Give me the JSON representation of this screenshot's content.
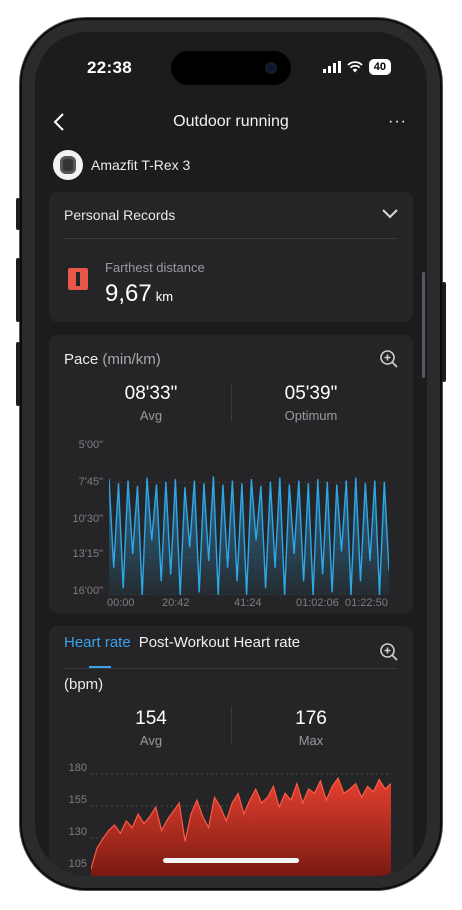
{
  "status_bar": {
    "time": "22:38",
    "battery": "40"
  },
  "header": {
    "title": "Outdoor running",
    "more": "···"
  },
  "device": {
    "name": "Amazfit T-Rex 3"
  },
  "personal_records": {
    "title": "Personal Records",
    "record_label": "Farthest distance",
    "record_value": "9,67",
    "record_unit": "km"
  },
  "pace": {
    "title": "Pace",
    "unit": "(min/km)",
    "avg_value": "08'33\"",
    "avg_label": "Avg",
    "optimum_value": "05'39\"",
    "optimum_label": "Optimum",
    "y_ticks": [
      "5'00\"",
      "7'45\"",
      "10'30\"",
      "13'15\"",
      "16'00\""
    ],
    "x_ticks": [
      "00:00",
      "20:42",
      "41:24",
      "01:02:06",
      "01:22:50"
    ]
  },
  "heart_rate": {
    "tab_active": "Heart rate",
    "tab_other": "Post-Workout Heart rate",
    "unit": "(bpm)",
    "avg_value": "154",
    "avg_label": "Avg",
    "max_value": "176",
    "max_label": "Max",
    "y_ticks": [
      "180",
      "155",
      "130",
      "105"
    ]
  },
  "colors": {
    "pace_line": "#2fa6e6",
    "heart_fill": "#e5402f",
    "accent": "#3aa0e8"
  },
  "chart_data": [
    {
      "type": "area",
      "title": "Pace",
      "ylabel": "(min/km)",
      "y_ticks": [
        "5'00\"",
        "7'45\"",
        "10'30\"",
        "13'15\"",
        "16'00\""
      ],
      "x_ticks": [
        "00:00",
        "20:42",
        "41:24",
        "01:02:06",
        "01:22:50"
      ],
      "ylim_min_per_km": [
        5.0,
        16.0
      ],
      "y_inverted": true,
      "series": [
        {
          "values": [
            7.5,
            14,
            7.8,
            15.5,
            7.6,
            13,
            8,
            16,
            7.4,
            12,
            7.9,
            15,
            7.7,
            14.5,
            7.5,
            16,
            8.1,
            12.5,
            7.6,
            15.8,
            7.8,
            13.5,
            7.3,
            16,
            7.9,
            14,
            7.6,
            15,
            7.8,
            16,
            7.5,
            12,
            8,
            15.5,
            7.7,
            14,
            7.4,
            16,
            7.9,
            13,
            7.6,
            15,
            7.8,
            16,
            7.5,
            14.5,
            7.7,
            15.8,
            7.9,
            12.8,
            7.6,
            16,
            7.4,
            15,
            7.8,
            13.5,
            7.6,
            16,
            7.7,
            14.2
          ]
        }
      ]
    },
    {
      "type": "area",
      "title": "Heart rate",
      "ylabel": "(bpm)",
      "y_ticks": [
        "180",
        "155",
        "130",
        "105"
      ],
      "ylim": [
        105,
        180
      ],
      "series": [
        {
          "values": [
            110,
            125,
            132,
            138,
            142,
            136,
            145,
            140,
            150,
            143,
            148,
            155,
            138,
            146,
            152,
            158,
            130,
            150,
            160,
            148,
            140,
            162,
            155,
            145,
            158,
            165,
            150,
            160,
            168,
            158,
            162,
            170,
            155,
            165,
            160,
            172,
            158,
            168,
            165,
            174,
            160,
            170,
            176,
            165,
            168,
            172,
            162,
            170,
            166,
            175,
            168,
            172
          ]
        }
      ]
    }
  ]
}
